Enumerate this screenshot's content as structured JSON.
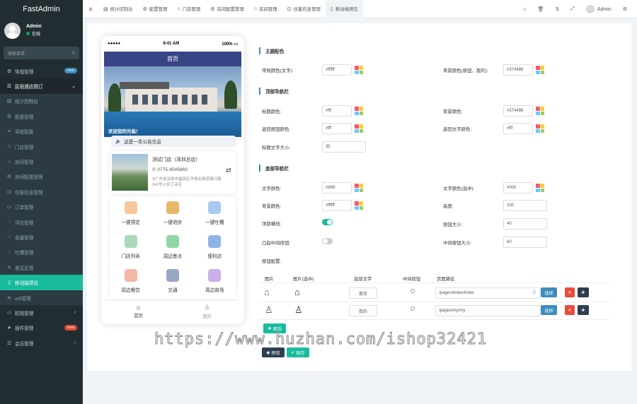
{
  "sidebar": {
    "app_name": "FastAdmin",
    "user": {
      "name": "Admin",
      "status": "在线"
    },
    "search_placeholder": "搜索菜单",
    "items": [
      {
        "label": "常规管理",
        "badge": "new",
        "badge_color": "#3c8dbc"
      },
      {
        "label": "民宿酒店预订",
        "open": true
      },
      {
        "label": "统计控制台"
      },
      {
        "label": "配置管理"
      },
      {
        "label": "导航配置"
      },
      {
        "label": "门店管理"
      },
      {
        "label": "房间管理"
      },
      {
        "label": "房间配置管理"
      },
      {
        "label": "住客信息管理"
      },
      {
        "label": "订单管理"
      },
      {
        "label": "评论管理"
      },
      {
        "label": "收藏管理"
      },
      {
        "label": "吐槽管理"
      },
      {
        "label": "意见反馈"
      },
      {
        "label": "移动端预览",
        "active": true
      },
      {
        "label": "wifi管理"
      },
      {
        "label": "权限管理"
      },
      {
        "label": "插件管理",
        "badge": "new",
        "badge_color": "#dd4b39"
      },
      {
        "label": "会员管理"
      }
    ]
  },
  "topbar": {
    "tabs": [
      "统计控制台",
      "配置管理",
      "门店管理",
      "房间配置管理",
      "房间管理",
      "住客信息管理",
      "移动端预览"
    ],
    "user": "Admin"
  },
  "phone": {
    "time": "9:41 AM",
    "battery": "100%",
    "title": "首页",
    "welcome": "欢迎您的光临！",
    "notice": "这是一条公告信息",
    "store": {
      "name": "测试门店（深圳总店）",
      "phone": "0775-8545869",
      "address": "广东省深圳市福田区华强北街道振兴路341号上步工业区"
    },
    "grid": [
      {
        "label": "一键预定",
        "color": "#f6c89a"
      },
      {
        "label": "一键退房",
        "color": "#e7b86a"
      },
      {
        "label": "一键吐槽",
        "color": "#a8c9f0"
      },
      {
        "label": "门店列表",
        "color": "#a9d9b8"
      },
      {
        "label": "周边景点",
        "color": "#8fd6a6"
      },
      {
        "label": "便利店",
        "color": "#8fb3e6"
      },
      {
        "label": "周边餐饮",
        "color": "#f2b8a6"
      },
      {
        "label": "交通",
        "color": "#9aa6c6"
      },
      {
        "label": "周边商场",
        "color": "#c8b0e8"
      }
    ],
    "tabbar": [
      "首页",
      "我的"
    ]
  },
  "form": {
    "theme": {
      "title": "主题配色",
      "main_label": "常规颜色(文字):",
      "main_value": "#ffffff",
      "bg_label": "背景颜色(按钮、我的):",
      "bg_value": "#374486"
    },
    "top_nav": {
      "title": "顶部导航栏",
      "title_color_label": "标题颜色:",
      "title_color_value": "#fff",
      "bg_label": "背景颜色:",
      "bg_value": "#374486",
      "back_btn_label": "返回按钮颜色:",
      "back_btn_value": "#fff",
      "back_text_label": "返回文字颜色:",
      "back_text_value": "#fff",
      "font_size_label": "标题文字大小:",
      "font_size_value": "35"
    },
    "bottom_nav": {
      "title": "底部导航栏",
      "text_color_label": "文字颜色:",
      "text_color_value": "#999",
      "text_sel_label": "文字颜色(选中):",
      "text_sel_value": "#000",
      "bg_label": "背景颜色:",
      "bg_value": "#ffffff",
      "height_label": "高度:",
      "height_value": "100",
      "border_label": "顶部横线:",
      "btn_size_label": "按钮大小:",
      "btn_size_value": "40",
      "convex_label": "凸起中间按钮:",
      "mid_size_label": "中间按钮大小:",
      "mid_size_value": "60"
    },
    "buttons": {
      "title": "按钮配置:",
      "headers": [
        "图片",
        "图片(选中)",
        "底部文字",
        "中间按钮",
        "页面路径"
      ],
      "rows": [
        {
          "text": "首页",
          "path": "/pages/index/index"
        },
        {
          "text": "我的",
          "path": "/pages/my/my"
        }
      ],
      "choose": "选择",
      "add": "添加"
    },
    "preview_btn": "预览",
    "save_btn": "保存"
  },
  "watermark": "https://www.huzhan.com/ishop32421"
}
